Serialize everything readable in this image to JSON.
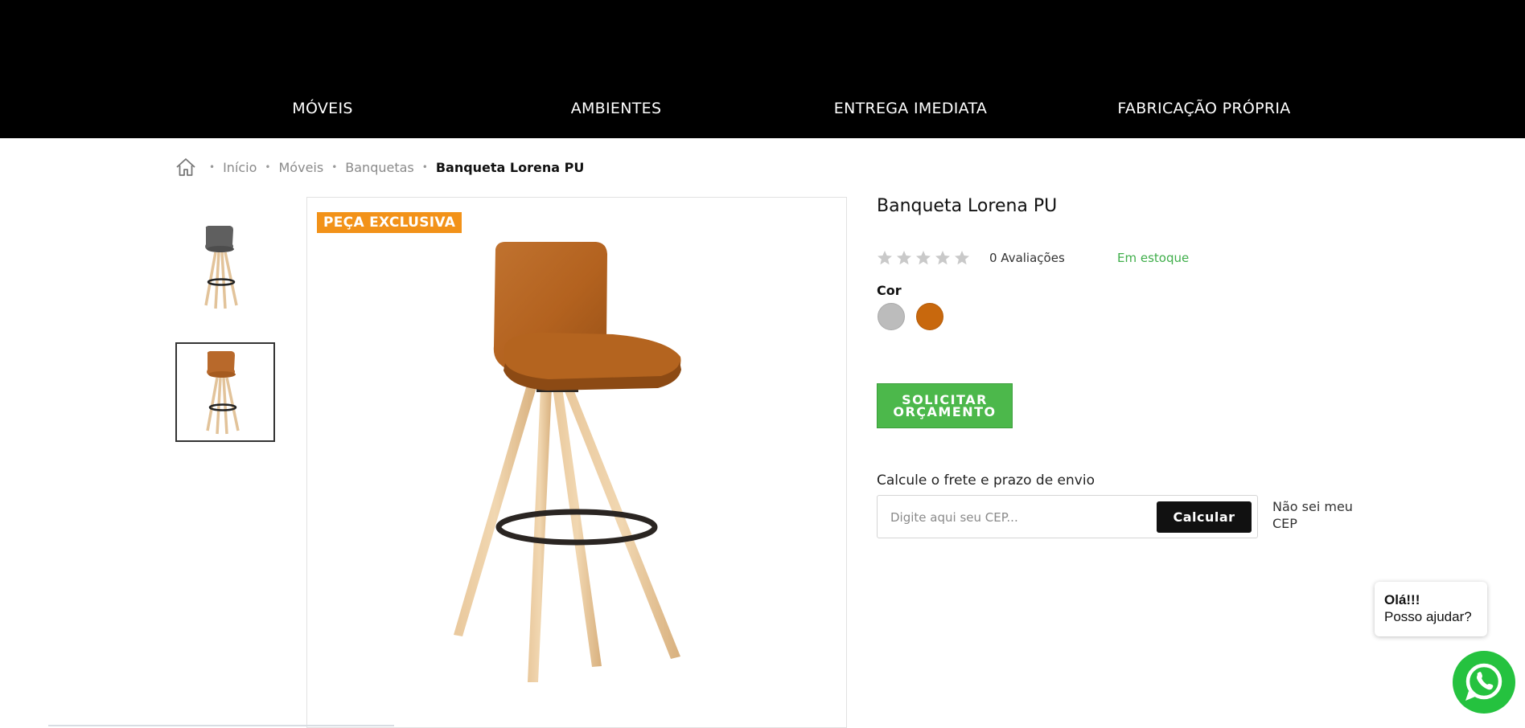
{
  "nav": {
    "items": [
      "MÓVEIS",
      "AMBIENTES",
      "ENTREGA IMEDIATA",
      "FABRICAÇÃO PRÓPRIA"
    ]
  },
  "breadcrumb": {
    "items": [
      "Início",
      "Móveis",
      "Banquetas"
    ],
    "current": "Banqueta Lorena PU"
  },
  "gallery": {
    "badge": "PEÇA EXCLUSIVA",
    "selected_index": 1
  },
  "product": {
    "title": "Banqueta Lorena PU",
    "rating": 0,
    "rating_max": 5,
    "reviews": "0 Avaliações",
    "stock": "Em estoque",
    "color_label": "Cor",
    "colors": [
      "#bcbcbc",
      "#c8680d"
    ],
    "quote_button": "SOLICITAR ORÇAMENTO"
  },
  "shipping": {
    "label": "Calcule o frete e prazo de envio",
    "placeholder": "Digite aqui seu CEP...",
    "button": "Calcular",
    "no_cep": "Não sei meu CEP"
  },
  "chat": {
    "greeting": "Olá!!!",
    "help": "Posso ajudar?"
  },
  "colors": {
    "header": "#000000",
    "accent_green": "#4cb84b",
    "badge_orange": "#f29219",
    "stock_green": "#3fae4a",
    "whatsapp": "#25c23f"
  }
}
